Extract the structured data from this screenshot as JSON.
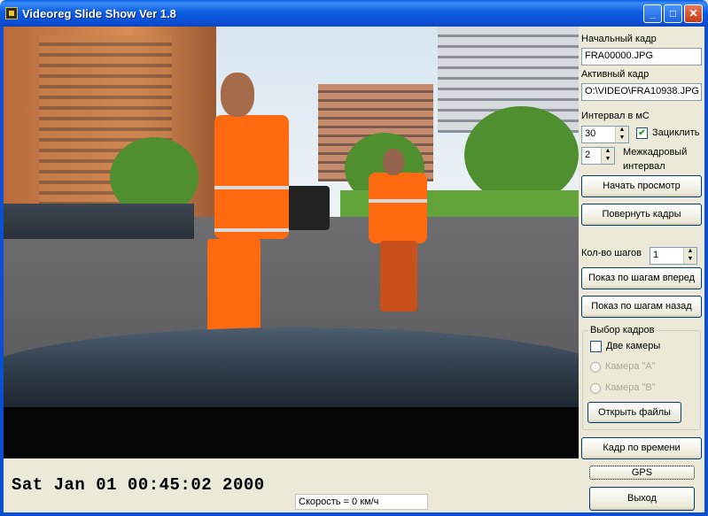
{
  "window": {
    "title": "Videoreg Slide Show Ver 1.8",
    "controls": {
      "minimize": "_",
      "maximize": "□",
      "close": "✕"
    }
  },
  "video": {
    "scene": ""
  },
  "status": {
    "timestamp": "Sat Jan 01 00:45:02 2000",
    "speed": "Скорость = 0 км/ч"
  },
  "panel": {
    "start_frame_label": "Начальный кадр",
    "start_frame_value": "FRA00000.JPG",
    "active_frame_label": "Активный кадр",
    "active_frame_value": "O:\\VIDEO\\FRA10938.JPG",
    "interval_label": "Интервал в мС",
    "interval_value": "30",
    "loop_label": "Зациклить",
    "loop_checked": true,
    "interframe_value": "2",
    "interframe_label_1": "Межкадровый",
    "interframe_label_2": "интервал",
    "start_view_button": "Начать просмотр",
    "rotate_button": "Повернуть кадры",
    "steps_label": "Кол-во шагов",
    "steps_value": "1",
    "step_forward_button": "Показ по шагам вперед",
    "step_back_button": "Показ по шагам назад",
    "frame_select_group": "Выбор кадров",
    "two_cameras_label": "Две камеры",
    "two_cameras_checked": false,
    "camera_a_label": "Камера \"А\"",
    "camera_b_label": "Камера \"В\"",
    "open_files_button": "Открыть файлы",
    "frame_by_time_button": "Кадр по времени",
    "gps_button": "GPS",
    "exit_button": "Выход"
  }
}
